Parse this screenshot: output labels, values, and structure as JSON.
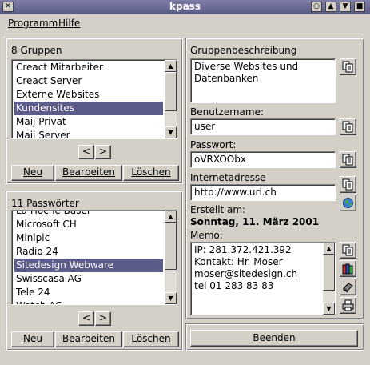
{
  "window": {
    "title": "kpass"
  },
  "menu": {
    "items": [
      "Programm",
      "Hilfe"
    ]
  },
  "groups": {
    "header": "8 Gruppen",
    "items": [
      "Creact Mitarbeiter",
      "Creact Server",
      "Externe Websites",
      "Kundensites",
      "Maij Privat",
      "Maij Server"
    ],
    "selected_index": 3,
    "prev_label": "<",
    "next_label": ">",
    "new_label": "Neu",
    "edit_label": "Bearbeiten",
    "delete_label": "Löschen"
  },
  "passwords": {
    "header": "11 Passwörter",
    "items": [
      "La Hoche Basel",
      "Microsoft CH",
      "Minipic",
      "Radio 24",
      "Sitedesign Webware",
      "Swisscasa AG",
      "Tele 24",
      "Watch AG"
    ],
    "selected_index": 4,
    "prev_label": "<",
    "next_label": ">",
    "new_label": "Neu",
    "edit_label": "Bearbeiten",
    "delete_label": "Löschen"
  },
  "details": {
    "group_desc_label": "Gruppenbeschreibung",
    "group_desc_line1": "Diverse Websites und",
    "group_desc_line2": "Datenbanken",
    "username_label": "Benutzername:",
    "username_value": "user",
    "password_label": "Passwort:",
    "password_value": "oVRXOObx",
    "url_label": "Internetadresse",
    "url_value": "http://www.url.ch",
    "created_label": "Erstellt am:",
    "created_value": "Sonntag, 11. März 2001",
    "memo_label": "Memo:",
    "memo_lines": [
      "IP: 281.372.421.392",
      "Kontakt: Hr. Moser",
      "moser@sitedesign.ch",
      "tel 01 283 83 83"
    ]
  },
  "footer": {
    "quit_label": "Beenden"
  },
  "colors": {
    "selection": "#5c5c8a",
    "window_bg": "#d4d0c8",
    "titlebar": "#6e6e9a"
  }
}
